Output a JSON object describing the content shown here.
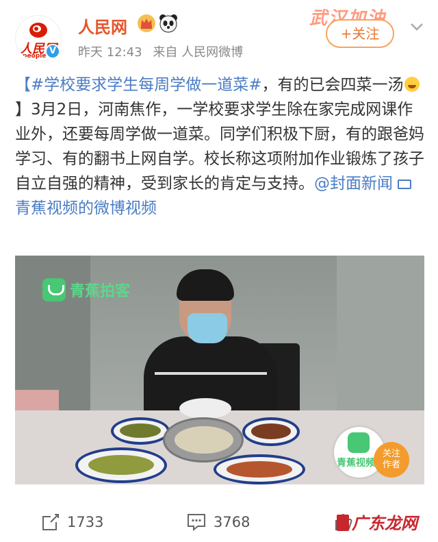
{
  "header": {
    "username": "人民网",
    "logo_text": "人民网",
    "logo_sub": "people",
    "time": "昨天 12:43",
    "source": "来自 人民网微博",
    "follow_label": "+关注",
    "banner_text": "武汉加油"
  },
  "post": {
    "hashtag": "【#学校要求学生每周学做一道菜#",
    "text_1": "，有的已会四菜一汤",
    "text_2": "】3月2日，河南焦作，一学校要求学生除在家完成网课作业外，还要每周学做一道菜。同学们积极下厨，有的跟爸妈学习、有的翻书上网自学。校长称这项附加作业锻炼了孩子自立自强的精神，受到家长的肯定与支持。",
    "mention": "@封面新闻",
    "video_link": "青蕉视频的微博视频"
  },
  "video": {
    "watermark": "青蕉拍客",
    "badge_text": "青蕉视频",
    "follow_author": "关注\n作者"
  },
  "footer": {
    "reposts": "1733",
    "comments": "3768"
  },
  "site_watermark": "广东龙网",
  "colors": {
    "accent": "#e5542a",
    "link": "#4a7cc4",
    "follow_border": "#f7a35c"
  }
}
